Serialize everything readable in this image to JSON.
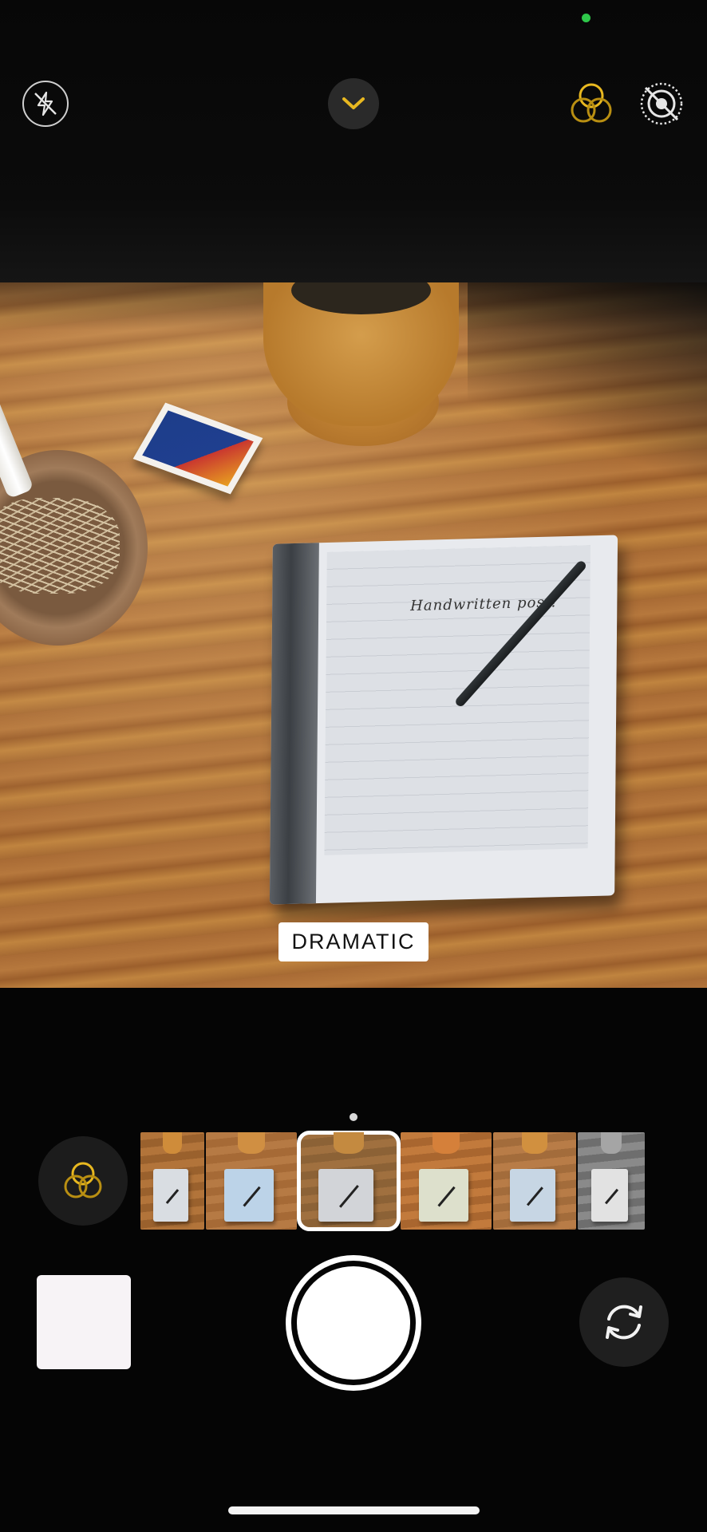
{
  "colors": {
    "accent_yellow": "#e8b820",
    "status_green": "#2ec84a"
  },
  "top_controls": {
    "flash_icon": "flash-off-icon",
    "chevron_icon": "chevron-down-icon",
    "filters_icon": "filters-icon",
    "live_icon": "live-photo-off-icon"
  },
  "viewfinder": {
    "filter_name": "DRAMATIC",
    "handwriting": "Handwritten post!"
  },
  "filter_strip": {
    "filters": [
      {
        "w1": "#b2743a",
        "w2": "#9a612d",
        "tab": "#d9dde2",
        "pot": "#cf8c3a"
      },
      {
        "w1": "#b67a44",
        "w2": "#a66a36",
        "tab": "#bcd3e8",
        "pot": "#d08f42"
      },
      {
        "w1": "#a0703f",
        "w2": "#8c6236",
        "tab": "#d2d4d8",
        "pot": "#c48a40",
        "selected": true
      },
      {
        "w1": "#c27a3c",
        "w2": "#a9662f",
        "tab": "#dde0cc",
        "pot": "#d5803a"
      },
      {
        "w1": "#b87c47",
        "w2": "#a36c3b",
        "tab": "#c7d6e4",
        "pot": "#d1903f"
      },
      {
        "w1": "#8a8a8a",
        "w2": "#6e6e6e",
        "tab": "#e2e2e2",
        "pot": "#a5a5a5"
      }
    ]
  },
  "bottom_controls": {
    "filters_icon": "filters-icon",
    "flip_icon": "camera-flip-icon"
  }
}
